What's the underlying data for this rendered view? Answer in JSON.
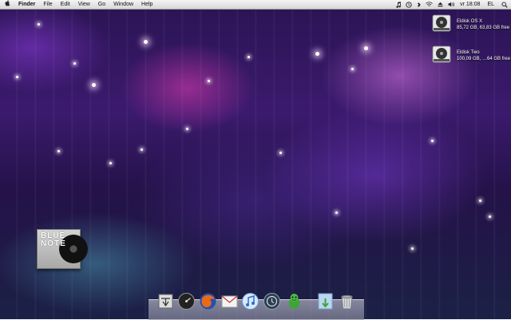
{
  "menubar": {
    "app_name": "Finder",
    "menus": [
      "File",
      "Edit",
      "View",
      "Go",
      "Window",
      "Help"
    ],
    "status": {
      "time": "vr 18:08",
      "input_source": "EL"
    }
  },
  "desktop": {
    "drives": [
      {
        "name": "Eldisk OS X",
        "info": "85,72 GB, 63,83 GB free"
      },
      {
        "name": "Eldisk Two",
        "info": "100,09 GB, …64 GB free"
      }
    ],
    "album": {
      "title_line1": "BLUE",
      "title_line2": "NOTE"
    }
  },
  "dock": {
    "items": [
      {
        "name": "app-icon"
      },
      {
        "name": "dashboard-icon"
      },
      {
        "name": "firefox-icon"
      },
      {
        "name": "mail-icon"
      },
      {
        "name": "itunes-icon"
      },
      {
        "name": "time-machine-icon"
      },
      {
        "name": "adium-icon"
      },
      {
        "name": "downloads-icon"
      },
      {
        "name": "trash-icon"
      }
    ]
  }
}
